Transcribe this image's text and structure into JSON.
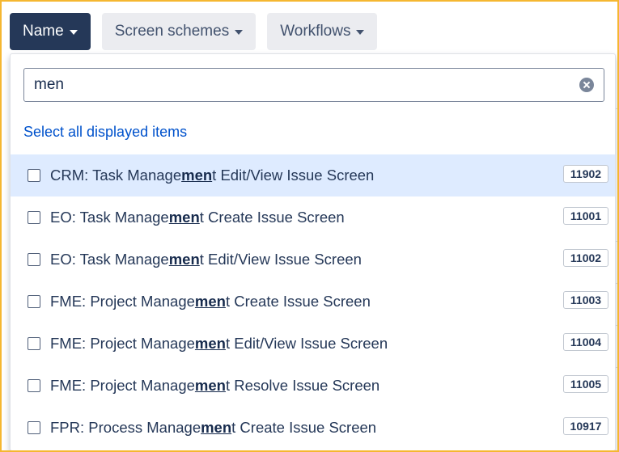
{
  "toolbar": {
    "buttons": [
      {
        "label": "Name",
        "active": true
      },
      {
        "label": "Screen schemes",
        "active": false
      },
      {
        "label": "Workflows",
        "active": false
      }
    ]
  },
  "dropdown": {
    "search": {
      "value": "men",
      "placeholder": ""
    },
    "select_all_label": "Select all displayed items",
    "items": [
      {
        "pre": "CRM: Task Manage",
        "match": "men",
        "post": "t Edit/View Issue Screen",
        "id": "11902",
        "highlighted": true
      },
      {
        "pre": "EO: Task Manage",
        "match": "men",
        "post": "t Create Issue Screen",
        "id": "11001",
        "highlighted": false
      },
      {
        "pre": "EO: Task Manage",
        "match": "men",
        "post": "t Edit/View Issue Screen",
        "id": "11002",
        "highlighted": false
      },
      {
        "pre": "FME: Project Manage",
        "match": "men",
        "post": "t Create Issue Screen",
        "id": "11003",
        "highlighted": false
      },
      {
        "pre": "FME: Project Manage",
        "match": "men",
        "post": "t Edit/View Issue Screen",
        "id": "11004",
        "highlighted": false
      },
      {
        "pre": "FME: Project Manage",
        "match": "men",
        "post": "t Resolve Issue Screen",
        "id": "11005",
        "highlighted": false
      },
      {
        "pre": "FPR: Process Manage",
        "match": "men",
        "post": "t Create Issue Screen",
        "id": "10917",
        "highlighted": false
      }
    ]
  },
  "colors": {
    "frame_border": "#f5b731",
    "active_button": "#253858",
    "highlight_row": "#deebff",
    "link": "#0052cc"
  }
}
